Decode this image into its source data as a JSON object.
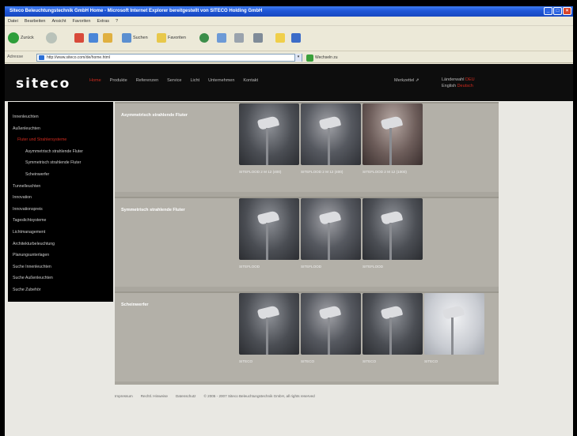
{
  "window": {
    "title": "Siteco Beleuchtungstechnik GmbH Home - Microsoft Internet Explorer bereitgestellt von SITECO Holding GmbH"
  },
  "menubar": [
    "Datei",
    "Bearbeiten",
    "Ansicht",
    "Favoriten",
    "Extras",
    "?"
  ],
  "toolbar": {
    "back_label": "Zurück",
    "search_label": "Suchen",
    "favorites_label": "Favoriten"
  },
  "address": {
    "label": "Adresse",
    "url": "http://www.siteco.com/de/home.html",
    "go_label": "Wechseln zu"
  },
  "site": {
    "logo": "siteco",
    "nav": [
      "Home",
      "Produkte",
      "Referenzen",
      "Service",
      "Licht",
      "Unternehmen",
      "Kontakt"
    ],
    "active_nav": "Home",
    "merkzettel": "Merkzettel",
    "lang": {
      "de": "Länderwahl",
      "de_red": "DEU",
      "en": "English",
      "en_red": "Deutsch"
    }
  },
  "sidebar": [
    {
      "label": "Innenleuchten",
      "level": 1
    },
    {
      "label": "Außenleuchten",
      "level": 1
    },
    {
      "label": "Fluter und Strahlersysteme",
      "level": 2,
      "active": true
    },
    {
      "label": "Asymmetrisch strahlende Fluter",
      "level": 3
    },
    {
      "label": "Symmetrisch strahlende Fluter",
      "level": 3
    },
    {
      "label": "Scheinwerfer",
      "level": 3
    },
    {
      "label": "Tunnelleuchten",
      "level": 1
    },
    {
      "label": "Innovation",
      "level": 1
    },
    {
      "label": "Innovationspreis",
      "level": 1
    },
    {
      "label": "Tageslichtsysteme",
      "level": 1
    },
    {
      "label": "Lichtmanagement",
      "level": 1
    },
    {
      "label": "Architekturbeleuchtung",
      "level": 1
    },
    {
      "label": "Planungsunterlagen",
      "level": 1
    },
    {
      "label": "Suche Innenleuchten",
      "level": 1
    },
    {
      "label": "Suche Außenleuchten",
      "level": 1
    },
    {
      "label": "Suche Zubehör",
      "level": 1
    }
  ],
  "sections": [
    {
      "title": "Asymmetrisch strahlende Fluter",
      "products": [
        {
          "caption": "SITEFLOOD 2 M 12 (400)",
          "style": "dark"
        },
        {
          "caption": "SITEFLOOD 2 M 12 (400)",
          "style": "dark2"
        },
        {
          "caption": "SITEFLOOD 2 M 12 (1000)",
          "style": "warm"
        }
      ]
    },
    {
      "title": "Symmetrisch strahlende Fluter",
      "products": [
        {
          "caption": "SITEFLOOD",
          "style": "dark"
        },
        {
          "caption": "SITEFLOOD",
          "style": "dark2"
        },
        {
          "caption": "SITEFLOOD",
          "style": "dark"
        }
      ]
    },
    {
      "title": "Scheinwerfer",
      "products": [
        {
          "caption": "SITECO",
          "style": "dark"
        },
        {
          "caption": "SITECO",
          "style": "dark2"
        },
        {
          "caption": "SITECO",
          "style": "dark"
        },
        {
          "caption": "SITECO",
          "style": "light"
        }
      ]
    }
  ],
  "footer": [
    "Impressum",
    "Rechtl. Hinweise",
    "Datenschutz",
    "© 2005 - 2007 Siteco Beleuchtungstechnik GmbH, all rights reserved"
  ]
}
